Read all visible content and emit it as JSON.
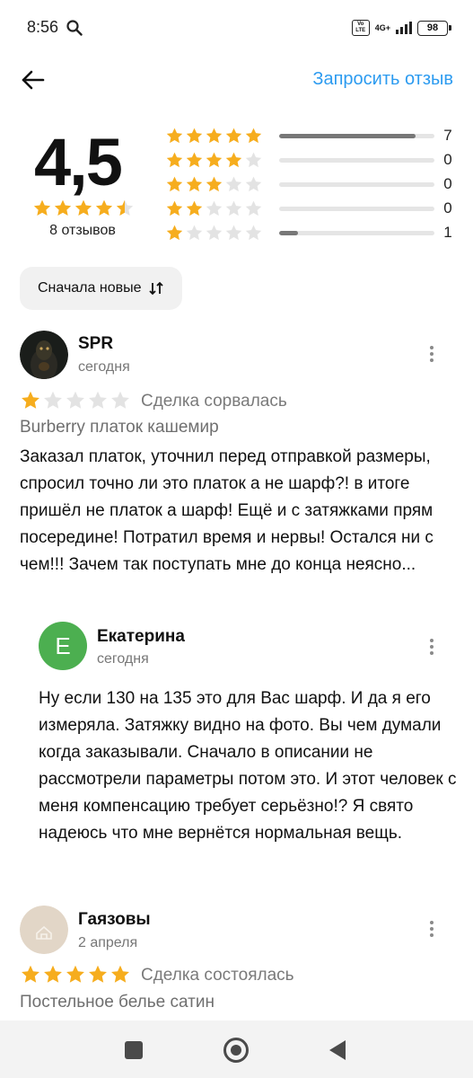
{
  "status_bar": {
    "time": "8:56",
    "volte_text": "Vo LTE",
    "network": "4G+",
    "battery": "98"
  },
  "header": {
    "request_review": "Запросить отзыв"
  },
  "summary": {
    "average": "4,5",
    "average_stars": 4.5,
    "review_count": "8 отзывов",
    "distribution": [
      {
        "stars": 5,
        "count": "7",
        "fraction": 0.88
      },
      {
        "stars": 4,
        "count": "0",
        "fraction": 0
      },
      {
        "stars": 3,
        "count": "0",
        "fraction": 0
      },
      {
        "stars": 2,
        "count": "0",
        "fraction": 0
      },
      {
        "stars": 1,
        "count": "1",
        "fraction": 0.12
      }
    ]
  },
  "sort": {
    "label": "Сначала новые"
  },
  "reviews": [
    {
      "name": "SPR",
      "date": "сегодня",
      "rating": 1,
      "deal_status": "Сделка сорвалась",
      "product": "Burberry платок кашемир",
      "text": "Заказал платок, уточнил перед отправкой размеры, спросил точно ли это платок а не шарф?! в итоге пришёл не платок а шарф! Ещё и с затяжками прям посередине! Потратил время и нервы! Остался ни с чем!!! Зачем так поступать мне до конца неясно...",
      "reply": {
        "initial": "Е",
        "name": "Екатерина",
        "date": "сегодня",
        "text": "Ну если 130 на 135 это для Вас шарф. И да я его измеряла. Затяжку видно на фото. Вы чем думали когда заказывали. Сначало в описании не рассмотрели параметры потом это. И этот человек с меня компенсацию требует серьёзно!? Я свято надеюсь что мне вернётся нормальная вещь."
      }
    },
    {
      "name": "Гаязовы",
      "date": "2 апреля",
      "rating": 5,
      "deal_status": "Сделка состоялась",
      "product": "Постельное белье сатин"
    }
  ],
  "colors": {
    "accent": "#2c9bf0",
    "star": "#f6ad1e",
    "star_empty": "#e3e3e3",
    "reply_avatar": "#4caf50",
    "avatar_beige": "#e2d6c7"
  },
  "icons": {
    "back": "arrow-left-icon",
    "sort": "sort-arrows-icon",
    "more": "more-vertical-icon",
    "search": "search-icon"
  }
}
